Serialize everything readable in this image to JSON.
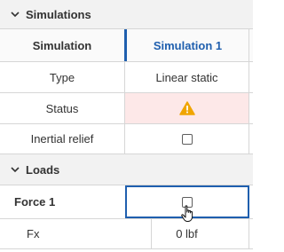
{
  "sections": {
    "simulations": {
      "title": "Simulations"
    },
    "loads": {
      "title": "Loads"
    }
  },
  "table": {
    "header": {
      "col1": "Simulation",
      "col2": "Simulation 1"
    },
    "rows": [
      {
        "label": "Type",
        "value": "Linear static"
      },
      {
        "label": "Status",
        "icon": "warning-icon"
      },
      {
        "label": "Inertial relief",
        "icon": "checkbox-unchecked"
      }
    ]
  },
  "loads": {
    "force": {
      "label": "Force 1",
      "icon": "checkbox-unchecked"
    },
    "fx": {
      "label": "Fx",
      "value": "0 lbf"
    }
  },
  "colors": {
    "accent": "#1f5fae",
    "warning_bg": "#fde8e8",
    "warning_icon": "#f0a500",
    "section_bg": "#f2f2f2"
  }
}
